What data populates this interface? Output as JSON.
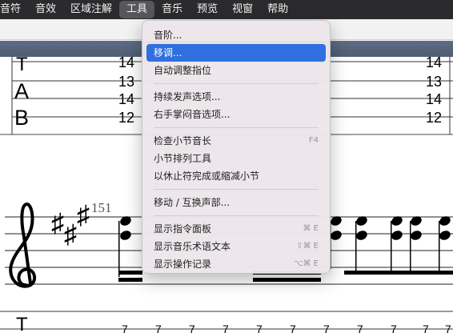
{
  "menubar": {
    "items": [
      "音符",
      "音效",
      "区域注解",
      "工具",
      "音乐",
      "预览",
      "视窗",
      "帮助"
    ],
    "active_index": 3
  },
  "dropdown": {
    "groups": [
      [
        {
          "label": "音阶..."
        },
        {
          "label": "移调...",
          "highlighted": true
        },
        {
          "label": "自动调整指位"
        }
      ],
      [
        {
          "label": "持续发声选项..."
        },
        {
          "label": "右手掌闷音选项..."
        }
      ],
      [
        {
          "label": "检查小节音长",
          "shortcut": "F4"
        },
        {
          "label": "小节排列工具"
        },
        {
          "label": "以休止符完成或缩减小节"
        }
      ],
      [
        {
          "label": "移动 / 互换声部..."
        }
      ],
      [
        {
          "label": "显示指令面板",
          "shortcut": "⌘ E"
        },
        {
          "label": "显示音乐术语文本",
          "shortcut": "⇧⌘ E"
        },
        {
          "label": "显示操作记录",
          "shortcut": "⌥⌘ E"
        }
      ]
    ]
  },
  "score": {
    "tab_clef": [
      "T",
      "A",
      "B"
    ],
    "measure_number": "151",
    "upper_left_frets": [
      "14",
      "13",
      "14",
      "12"
    ],
    "upper_right_frets": [
      "14",
      "13",
      "14",
      "12"
    ],
    "bottom_frets": [
      "7",
      "7",
      "7",
      "7",
      "7",
      "7",
      "7",
      "7",
      "7",
      "7",
      "7"
    ]
  },
  "colors": {
    "menubar_bg": "#2b2b2e",
    "highlight": "#2f6fde",
    "blueband": "#56667d"
  }
}
